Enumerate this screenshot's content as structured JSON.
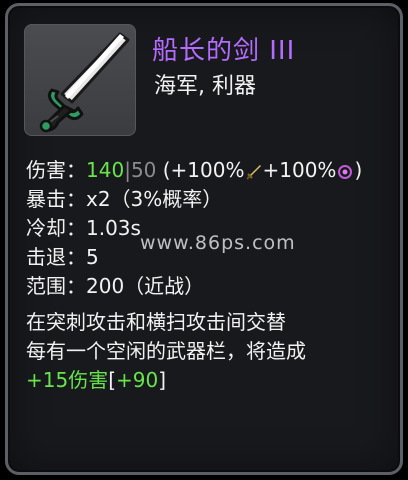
{
  "item": {
    "name": "船长的剑 III",
    "tags": "海军, 利器",
    "icon": "cutlass-sword-icon"
  },
  "stats": {
    "damage_label": "伤害：",
    "damage_value": "140",
    "damage_separator": "|",
    "damage_base": "50",
    "damage_bonus_open": "(+100%",
    "damage_bonus_mid": "+100%",
    "damage_bonus_close": ")",
    "crit_label": "暴击：",
    "crit_value": "x2（3%概率）",
    "cooldown_label": "冷却：",
    "cooldown_value": "1.03s",
    "knockback_label": "击退：",
    "knockback_value": "5",
    "range_label": "范围：",
    "range_value": "200（近战）"
  },
  "description": {
    "line1": "在突刺攻击和横扫攻击间交替",
    "line2": "每有一个空闲的武器栏，将造成",
    "bonus_damage": "+15伤害",
    "bonus_open": "[",
    "bonus_value": "+90",
    "bonus_close": "]"
  },
  "watermark": "www.86ps.com",
  "colors": {
    "title": "#b46cff",
    "green": "#67e54a",
    "text": "#f2f2f2",
    "muted": "#8a8b8f",
    "border": "#5b6066",
    "panel": "#18191d"
  }
}
